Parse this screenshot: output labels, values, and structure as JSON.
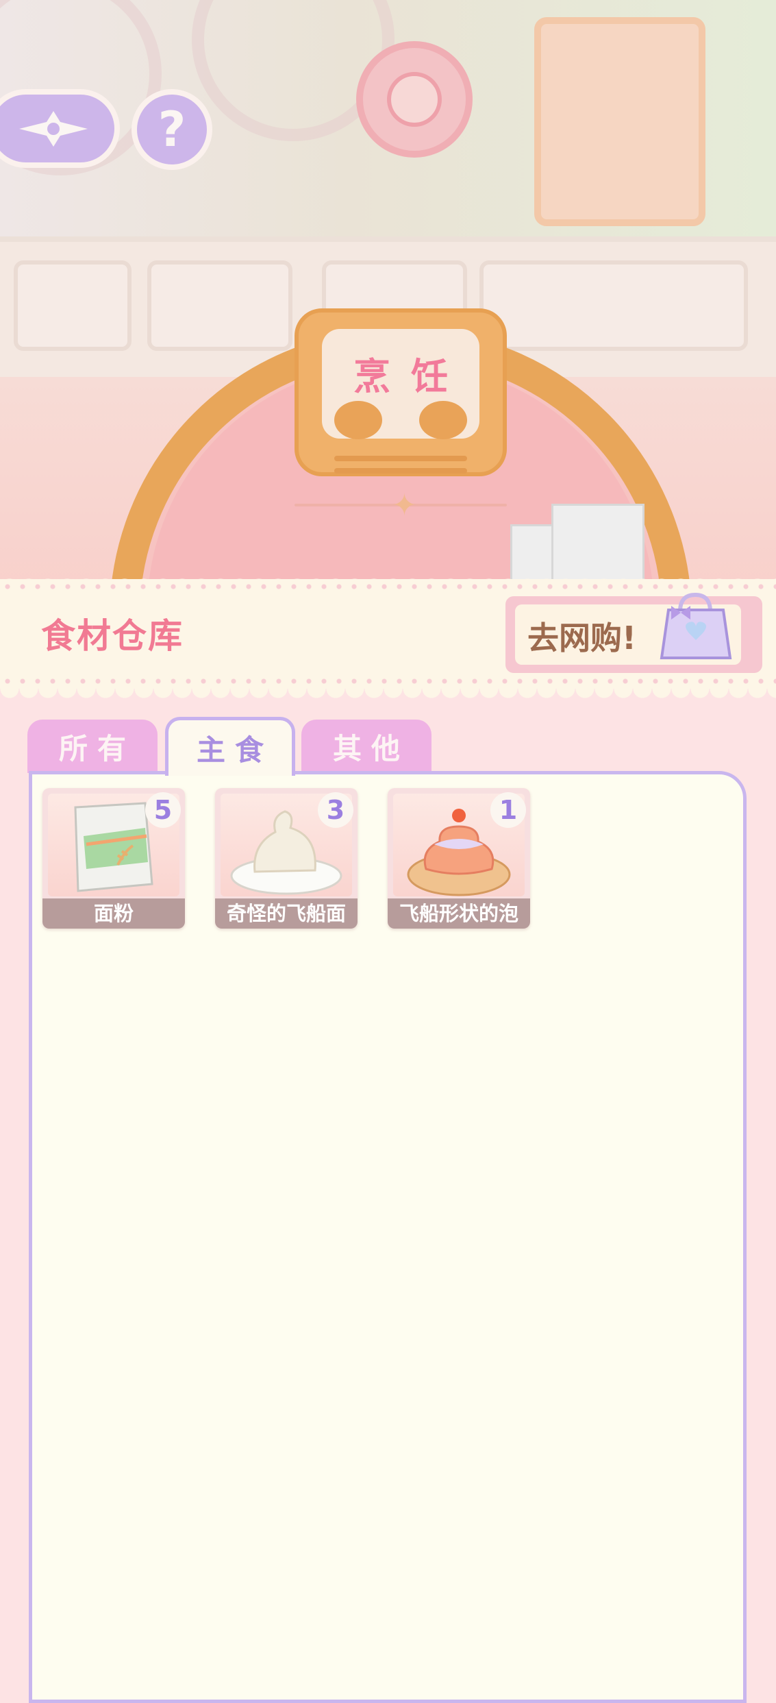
{
  "scene": {
    "sign_text": "烹饪"
  },
  "header": {
    "title": "食材仓库",
    "shop_label": "去网购!"
  },
  "tabs": [
    {
      "label": "所有",
      "active": false
    },
    {
      "label": "主食",
      "active": true
    },
    {
      "label": "其他",
      "active": false
    }
  ],
  "items": [
    {
      "name": "面粉",
      "count": "5",
      "icon": "flour-bag-icon"
    },
    {
      "name": "奇怪的飞船面",
      "count": "3",
      "icon": "dough-plate-icon"
    },
    {
      "name": "飞船形状的泡",
      "count": "1",
      "icon": "cream-puff-icon"
    }
  ],
  "colors": {
    "accent_pink": "#f17a93",
    "accent_purple": "#c9b6ee",
    "panel_bg": "#fefdf0"
  }
}
